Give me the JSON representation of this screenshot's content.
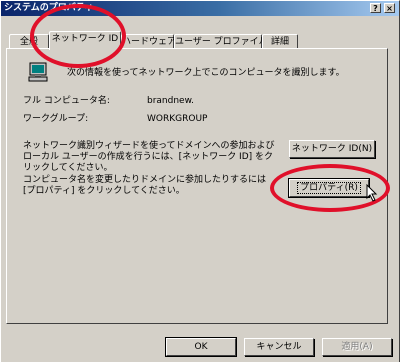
{
  "window": {
    "title": "システムのプロパティ",
    "help_button": "?",
    "close_button": "×"
  },
  "tabs": [
    {
      "label": "全般"
    },
    {
      "label": "ネットワーク ID"
    },
    {
      "label": "ハードウェア"
    },
    {
      "label": "ユーザー プロファイル"
    },
    {
      "label": "詳細"
    }
  ],
  "panel": {
    "intro_text": "次の情報を使ってネットワーク上でこのコンピュータを識別します。",
    "full_name_label": "フル コンピュータ名:",
    "full_name_value": "brandnew.",
    "workgroup_label": "ワークグループ:",
    "workgroup_value": "WORKGROUP",
    "wizard_text": "ネットワーク識別ウィザードを使ってドメインへの参加およびローカル ユーザーの作成を行うには、[ネットワーク ID] をクリックしてください。",
    "network_id_button": "ネットワーク ID(N)",
    "rename_text": "コンピュータ名を変更したりドメインに参加したりするには [プロパティ] をクリックしてください。",
    "properties_button": "プロパティ(R)"
  },
  "footer": {
    "ok_button": "OK",
    "cancel_button": "キャンセル",
    "apply_button": "適用(A)"
  },
  "colors": {
    "annotation": "#e0102a",
    "title_bar": "#0a246a",
    "dialog_face": "#d4d0c8"
  },
  "icons": {
    "computer": "computer-icon",
    "cursor": "mouse-pointer-icon"
  }
}
